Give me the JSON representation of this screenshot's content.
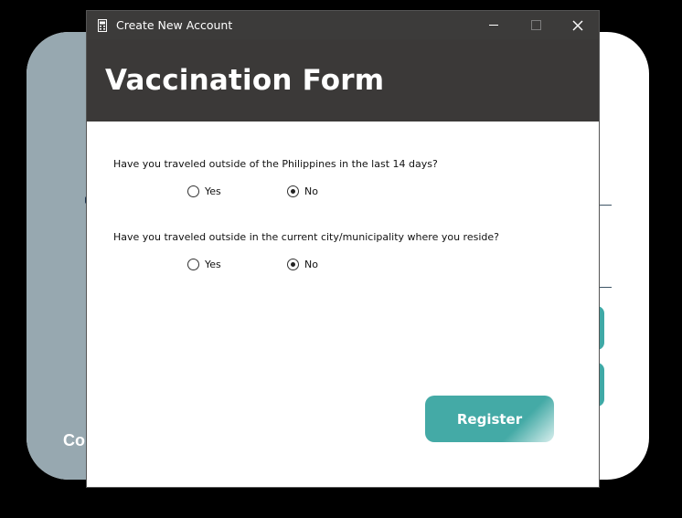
{
  "window": {
    "title": "Create New Account",
    "controls": [
      "minimize",
      "maximize",
      "close"
    ]
  },
  "background_window": {
    "partial_text": "Co"
  },
  "header": {
    "title": "Vaccination Form"
  },
  "questions": [
    {
      "text": "Have you traveled outside of the Philippines in the last 14 days?",
      "options": [
        {
          "label": "Yes",
          "checked": false
        },
        {
          "label": "No",
          "checked": true
        }
      ]
    },
    {
      "text": "Have you traveled outside in the current city/municipality where you reside?",
      "options": [
        {
          "label": "Yes",
          "checked": false
        },
        {
          "label": "No",
          "checked": true
        }
      ]
    }
  ],
  "actions": {
    "register_label": "Register"
  },
  "colors": {
    "header_bg": "#3b3938",
    "titlebar_bg": "#3c3b3a",
    "accent": "#44aaa6",
    "background_panel": "#97a8b0"
  }
}
